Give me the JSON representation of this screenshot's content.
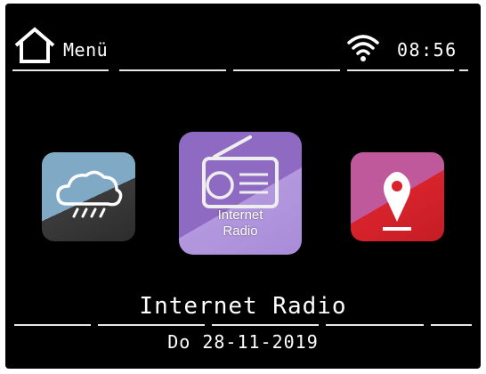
{
  "header": {
    "title": "Menü",
    "time": "08:56",
    "home_icon": "home-icon",
    "wifi_icon": "wifi-icon"
  },
  "carousel": {
    "items": [
      {
        "name": "weather",
        "icon": "cloud-rain-icon",
        "color": "#7fa9c4"
      },
      {
        "name": "internet-radio",
        "icon": "radio-icon",
        "label_line1": "Internet",
        "label_line2": "Radio",
        "color": "#8f6ac3",
        "selected": true
      },
      {
        "name": "map",
        "icon": "map-pin-icon",
        "color": "#d8232c"
      }
    ]
  },
  "footer": {
    "selected_title": "Internet Radio",
    "date": "Do 28-11-2019"
  }
}
